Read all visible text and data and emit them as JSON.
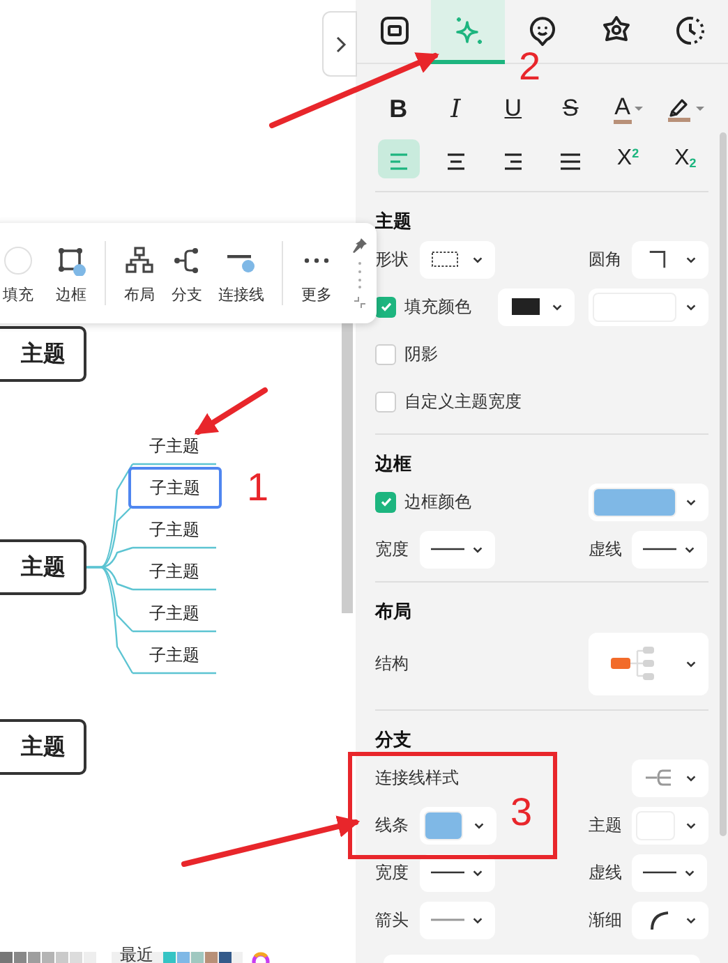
{
  "tabs": [
    {
      "kind": "frame",
      "selected": false
    },
    {
      "kind": "sparkle",
      "selected": true
    },
    {
      "kind": "sticker",
      "selected": false
    },
    {
      "kind": "flower",
      "selected": false
    },
    {
      "kind": "clock",
      "selected": false
    }
  ],
  "text_format": [
    {
      "kind": "bold",
      "label": "B"
    },
    {
      "kind": "italic",
      "label": "I"
    },
    {
      "kind": "underline",
      "label": "U"
    },
    {
      "kind": "strike",
      "label": "S"
    },
    {
      "kind": "font_color",
      "label": "A"
    },
    {
      "kind": "highlight"
    }
  ],
  "alignment": [
    {
      "kind": "left",
      "selected": true
    },
    {
      "kind": "center",
      "selected": false
    },
    {
      "kind": "right",
      "selected": false
    },
    {
      "kind": "justify",
      "selected": false
    },
    {
      "kind": "superscript",
      "label": "X",
      "mark": "2",
      "selected": false
    },
    {
      "kind": "subscript",
      "label": "X",
      "mark": "2",
      "selected": false
    }
  ],
  "sections": [
    {
      "title": "主题",
      "rows": [
        {
          "kind": "fields",
          "items": [
            {
              "label": "形状",
              "control": {
                "kind": "shape"
              }
            },
            {
              "label": "圆角",
              "control": {
                "kind": "corner"
              }
            }
          ]
        },
        {
          "kind": "check",
          "checked": true,
          "label": "填充颜色",
          "controls": [
            {
              "kind": "chip",
              "color": "#222222"
            },
            {
              "kind": "wide_swatch",
              "color": "#ffffff"
            }
          ]
        },
        {
          "kind": "check",
          "checked": false,
          "label": "阴影"
        },
        {
          "kind": "check",
          "checked": false,
          "label": "自定义主题宽度"
        }
      ]
    },
    {
      "title": "边框",
      "rows": [
        {
          "kind": "check",
          "checked": true,
          "label": "边框颜色",
          "controls": [
            {
              "kind": "wide_swatch",
              "color": "#7fb8e6"
            }
          ]
        },
        {
          "kind": "fields",
          "items": [
            {
              "label": "宽度",
              "control": {
                "kind": "line"
              }
            },
            {
              "label": "虚线",
              "control": {
                "kind": "line"
              }
            }
          ]
        }
      ]
    },
    {
      "title": "布局",
      "rows": [
        {
          "kind": "label_control",
          "label": "结构",
          "control": {
            "kind": "structure"
          }
        }
      ]
    },
    {
      "title": "分支",
      "rows": [
        {
          "kind": "label_control",
          "label": "连接线样式",
          "control": {
            "kind": "connector"
          }
        },
        {
          "kind": "fields",
          "items": [
            {
              "label": "线条",
              "control": {
                "kind": "swatch",
                "color": "#7fb8e6"
              }
            },
            {
              "label": "主题",
              "control": {
                "kind": "swatch",
                "color": "#ffffff"
              }
            }
          ]
        },
        {
          "kind": "fields",
          "items": [
            {
              "label": "宽度",
              "control": {
                "kind": "line"
              }
            },
            {
              "label": "虚线",
              "control": {
                "kind": "line"
              }
            }
          ]
        },
        {
          "kind": "fields",
          "items": [
            {
              "label": "箭头",
              "control": {
                "kind": "line_gray"
              }
            },
            {
              "label": "渐细",
              "control": {
                "kind": "curve"
              }
            }
          ]
        }
      ]
    }
  ],
  "toolbar": [
    {
      "kind": "fill",
      "label": "填充"
    },
    {
      "kind": "border",
      "label": "边框"
    },
    {
      "kind": "layout",
      "label": "布局",
      "separator_before": true
    },
    {
      "kind": "branch",
      "label": "分支"
    },
    {
      "kind": "connector",
      "label": "连接线"
    },
    {
      "kind": "more",
      "label": "更多",
      "separator_before": true
    }
  ],
  "mind_map": [
    {
      "text": "主题"
    },
    {
      "text": "主题",
      "children": [
        {
          "text": "子主题",
          "selected": false
        },
        {
          "text": "子主题",
          "selected": true
        },
        {
          "text": "子主题",
          "selected": false
        },
        {
          "text": "子主题",
          "selected": false
        },
        {
          "text": "子主题",
          "selected": false
        },
        {
          "text": "子主题",
          "selected": false
        }
      ]
    },
    {
      "text": "主题"
    }
  ],
  "palette": {
    "grays": [
      {
        "color": "#777777"
      },
      {
        "color": "#888888"
      },
      {
        "color": "#9e9e9e"
      },
      {
        "color": "#b4b4b4"
      },
      {
        "color": "#cacaca"
      },
      {
        "color": "#dcdcdc"
      },
      {
        "color": "#eeeeee"
      }
    ],
    "recent_label": "最近",
    "recent": [
      {
        "color": "#35c4c4"
      },
      {
        "color": "#7fb8e6"
      },
      {
        "color": "#a0c8c0"
      },
      {
        "color": "#b89078"
      },
      {
        "color": "#345a8a"
      }
    ]
  },
  "annotations": [
    {
      "text": "1"
    },
    {
      "text": "2"
    },
    {
      "text": "3"
    }
  ]
}
